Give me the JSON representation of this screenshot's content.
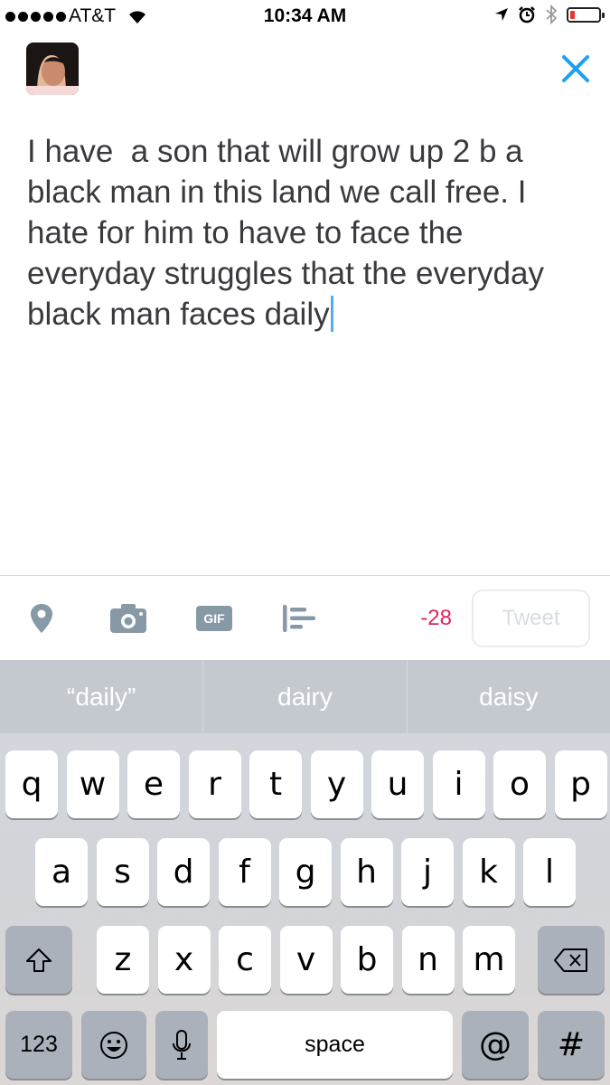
{
  "status_bar": {
    "carrier": "AT&T",
    "time": "10:34 AM",
    "battery_level": 0.15,
    "icons": [
      "signal-dots",
      "wifi-icon",
      "location-arrow-icon",
      "alarm-icon",
      "bluetooth-icon",
      "battery-icon"
    ]
  },
  "compose": {
    "text": "I have  a son that will grow up 2 b a\nblack man in this land we call free. I\nhate for him to have to face the\neveryday struggles that the everyday\nblack man faces daily"
  },
  "toolbar": {
    "icons": [
      "location-pin-icon",
      "camera-icon",
      "gif-icon",
      "poll-icon"
    ],
    "gif_label": "GIF",
    "char_count": "-28",
    "tweet_label": "Tweet"
  },
  "colors": {
    "accent": "#1da1f2",
    "char_count_over": "#e0245e",
    "toolbar_icon": "#8899a6"
  },
  "keyboard": {
    "suggestions": [
      "“daily”",
      "dairy",
      "daisy"
    ],
    "row1": [
      "q",
      "w",
      "e",
      "r",
      "t",
      "y",
      "u",
      "i",
      "o",
      "p"
    ],
    "row2": [
      "a",
      "s",
      "d",
      "f",
      "g",
      "h",
      "j",
      "k",
      "l"
    ],
    "row3": [
      "z",
      "x",
      "c",
      "v",
      "b",
      "n",
      "m"
    ],
    "numbers_label": "123",
    "at_label": "@",
    "hash_label": "#",
    "space_label": "space"
  }
}
